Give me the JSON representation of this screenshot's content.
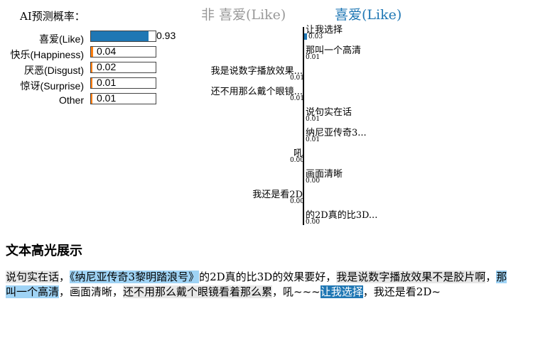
{
  "prediction": {
    "title": "AI预测概率：",
    "rows": [
      {
        "label": "喜爱(Like)",
        "value": 0.93,
        "value_text": "0.93",
        "color": "#1f77b4"
      },
      {
        "label": "快乐(Happiness)",
        "value": 0.04,
        "value_text": "0.04",
        "color": "#ff7f0e"
      },
      {
        "label": "厌恶(Disgust)",
        "value": 0.02,
        "value_text": "0.02",
        "color": "#ff7f0e"
      },
      {
        "label": "惊讶(Surprise)",
        "value": 0.01,
        "value_text": "0.01",
        "color": "#ff7f0e"
      },
      {
        "label": "Other",
        "value": 0.01,
        "value_text": "0.01",
        "color": "#ff7f0e"
      }
    ]
  },
  "explanation": {
    "negative_title": "非 喜爱(Like)",
    "positive_title": "喜爱(Like)",
    "features": [
      {
        "label": "让我选择",
        "value_text": "0.03",
        "side": "right",
        "bar": true
      },
      {
        "label": "那叫一个高清",
        "value_text": "0.01",
        "side": "right",
        "bar": false
      },
      {
        "label": "我是说数字播放效果...",
        "value_text": "0.01",
        "side": "left",
        "bar": false
      },
      {
        "label": "还不用那么戴个眼镜...",
        "value_text": "0.01",
        "side": "left",
        "bar": false
      },
      {
        "label": "说句实在话",
        "value_text": "0.01",
        "side": "right",
        "bar": false
      },
      {
        "label": "纳尼亚传奇3...",
        "value_text": "0.01",
        "side": "right",
        "bar": false
      },
      {
        "label": "吼",
        "value_text": "0.00",
        "side": "left",
        "bar": false
      },
      {
        "label": "画面清晰",
        "value_text": "0.00",
        "side": "right",
        "bar": false
      },
      {
        "label": "我还是看2D",
        "value_text": "0.00",
        "side": "left",
        "bar": false
      },
      {
        "label": "的2D真的比3D...",
        "value_text": "0.00",
        "side": "right",
        "bar": false
      }
    ],
    "bar_color": "#1f77b4"
  },
  "highlight": {
    "title": "文本高光展示",
    "segments": [
      {
        "text": "说句实在话",
        "kind": "neg"
      },
      {
        "text": "，",
        "kind": "plain"
      },
      {
        "text": "《纳尼亚传奇3黎明踏浪号》",
        "kind": "pos"
      },
      {
        "text": "的2D真的比3D的效果要好，",
        "kind": "plain"
      },
      {
        "text": "我是说数字播放效果不是胶片啊",
        "kind": "neg"
      },
      {
        "text": "，",
        "kind": "plain"
      },
      {
        "text": "那叫一个高清",
        "kind": "pos"
      },
      {
        "text": "，画面清晰，",
        "kind": "plain"
      },
      {
        "text": "还不用那么戴个眼镜看着那么累",
        "kind": "neg"
      },
      {
        "text": "，吼~~~",
        "kind": "plain"
      },
      {
        "text": "让我选择",
        "kind": "pos-strong"
      },
      {
        "text": "，我还是看2D~",
        "kind": "plain"
      }
    ]
  }
}
